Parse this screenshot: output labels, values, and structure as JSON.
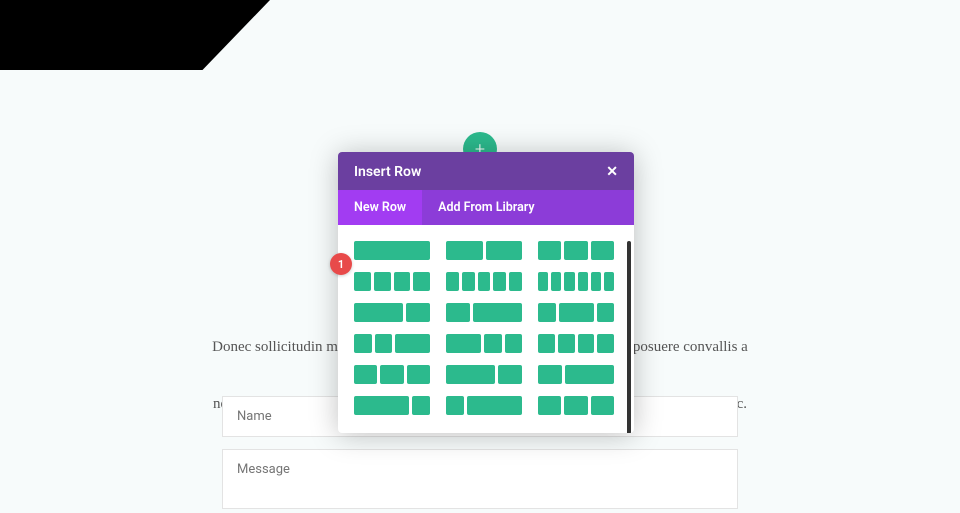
{
  "page": {
    "body_text_line1": "Donec sollicitudin molestie malesuada. Curabitur aliquet quam id dui posuere convallis a pellentesque",
    "body_text_line2": "nec, egestas non nisi. Curabitur aliquet quam id dui posuere convallis a pellentesque nec."
  },
  "form": {
    "name_placeholder": "Name",
    "message_placeholder": "Message"
  },
  "add_button": {
    "glyph": "+"
  },
  "modal": {
    "title": "Insert Row",
    "close_glyph": "✕",
    "tabs": {
      "new_row": "New Row",
      "add_from_library": "Add From Library"
    }
  },
  "badge": {
    "number": "1"
  },
  "colors": {
    "teal": "#2cba8d",
    "purple_header": "#6b3fa0",
    "purple_tabs": "#8c3cd8",
    "purple_tab_active": "#a23cf2",
    "badge_red": "#e84a4a"
  },
  "layout_options": [
    [
      [
        1
      ],
      [
        1,
        1
      ],
      [
        1,
        1,
        1
      ]
    ],
    [
      [
        1,
        1,
        1,
        1
      ],
      [
        1,
        1,
        1,
        1,
        1
      ],
      [
        1,
        1,
        1,
        1,
        1,
        1
      ]
    ],
    [
      [
        2,
        1
      ],
      [
        1,
        2
      ],
      [
        1,
        2,
        1
      ]
    ],
    [
      [
        1,
        1,
        2
      ],
      [
        2,
        1,
        1
      ],
      [
        1,
        1,
        1,
        1
      ]
    ],
    [
      [
        1,
        1,
        1
      ],
      [
        2,
        1
      ],
      [
        1,
        2
      ]
    ],
    [
      [
        3,
        1
      ],
      [
        1,
        3
      ],
      [
        1,
        1,
        1
      ]
    ]
  ]
}
